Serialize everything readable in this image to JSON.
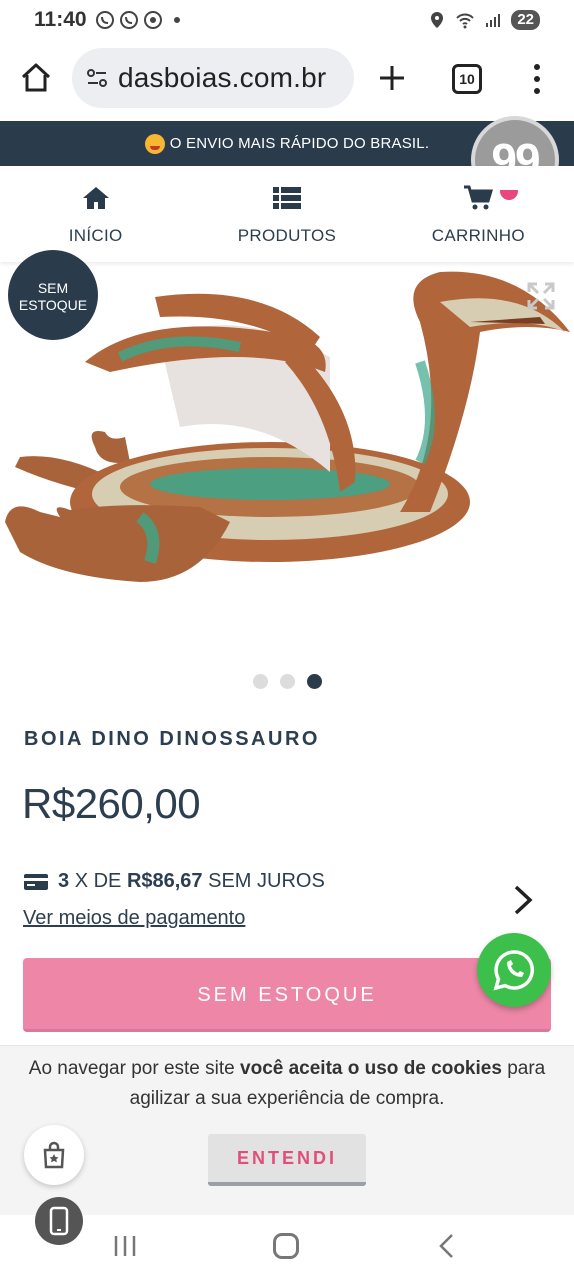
{
  "status_bar": {
    "time": "11:40",
    "battery": "22"
  },
  "browser": {
    "url": "dasboias.com.br",
    "tab_count": "10"
  },
  "promo": {
    "text": "O ENVIO MAIS RÁPIDO DO BRASIL."
  },
  "badge_99": "99",
  "nav": {
    "items": [
      {
        "label": "INÍCIO",
        "icon": "home-icon"
      },
      {
        "label": "PRODUTOS",
        "icon": "list-icon"
      },
      {
        "label": "CARRINHO",
        "icon": "cart-icon"
      }
    ]
  },
  "product": {
    "stock_badge_line1": "SEM",
    "stock_badge_line2": "ESTOQUE",
    "title": "BOIA DINO DINOSSAURO",
    "price": "R$260,00",
    "installments_count": "3",
    "installments_prefix": "X DE",
    "installments_value": "R$86,67",
    "installments_suffix": "SEM JUROS",
    "payment_link": "Ver meios de pagamento",
    "buy_button": "SEM ESTOQUE",
    "gallery_count": 3,
    "gallery_active": 3
  },
  "cookie": {
    "text_start": "Ao navegar por este site",
    "text_bold": "você aceita o uso de cookies",
    "text_end": "para agilizar a sua experiência de compra.",
    "button": "ENTENDI"
  },
  "colors": {
    "dark_navy": "#2a3b4c",
    "pink_button": "#ee87a7",
    "whatsapp_green": "#3dc04b",
    "cookie_accent": "#e04f7a"
  }
}
